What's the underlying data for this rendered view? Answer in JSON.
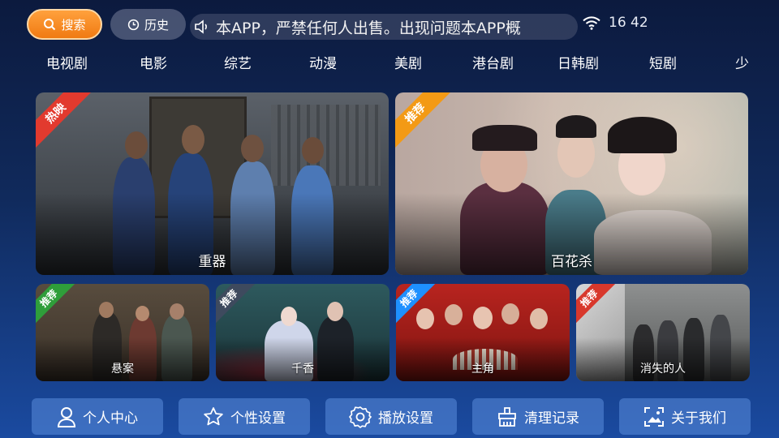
{
  "topbar": {
    "search_label": "搜索",
    "history_label": "历史",
    "marquee_text": "本APP，严禁任何人出售。出现问题本APP概",
    "time": "16 42"
  },
  "categories": [
    "电视剧",
    "电影",
    "综艺",
    "动漫",
    "美剧",
    "港台剧",
    "日韩剧",
    "短剧",
    "少"
  ],
  "featured": [
    {
      "title": "重器",
      "badge": "热映",
      "badge_color": "#e23a2e"
    },
    {
      "title": "百花杀",
      "badge": "推荐",
      "badge_color": "#f39a15"
    }
  ],
  "recommended": [
    {
      "title": "悬案",
      "badge": "推荐",
      "badge_color": "#2f9e3a"
    },
    {
      "title": "千香",
      "badge": "推荐",
      "badge_color": "#3e4a5e"
    },
    {
      "title": "主角",
      "badge": "推荐",
      "badge_color": "#1e90ff"
    },
    {
      "title": "消失的人",
      "badge": "推荐",
      "badge_color": "#d8382c"
    }
  ],
  "bottom_menu": [
    {
      "label": "个人中心",
      "icon": "person-icon"
    },
    {
      "label": "个性设置",
      "icon": "star-icon"
    },
    {
      "label": "播放设置",
      "icon": "gear-icon"
    },
    {
      "label": "清理记录",
      "icon": "broom-icon"
    },
    {
      "label": "关于我们",
      "icon": "image-frame-icon"
    }
  ]
}
